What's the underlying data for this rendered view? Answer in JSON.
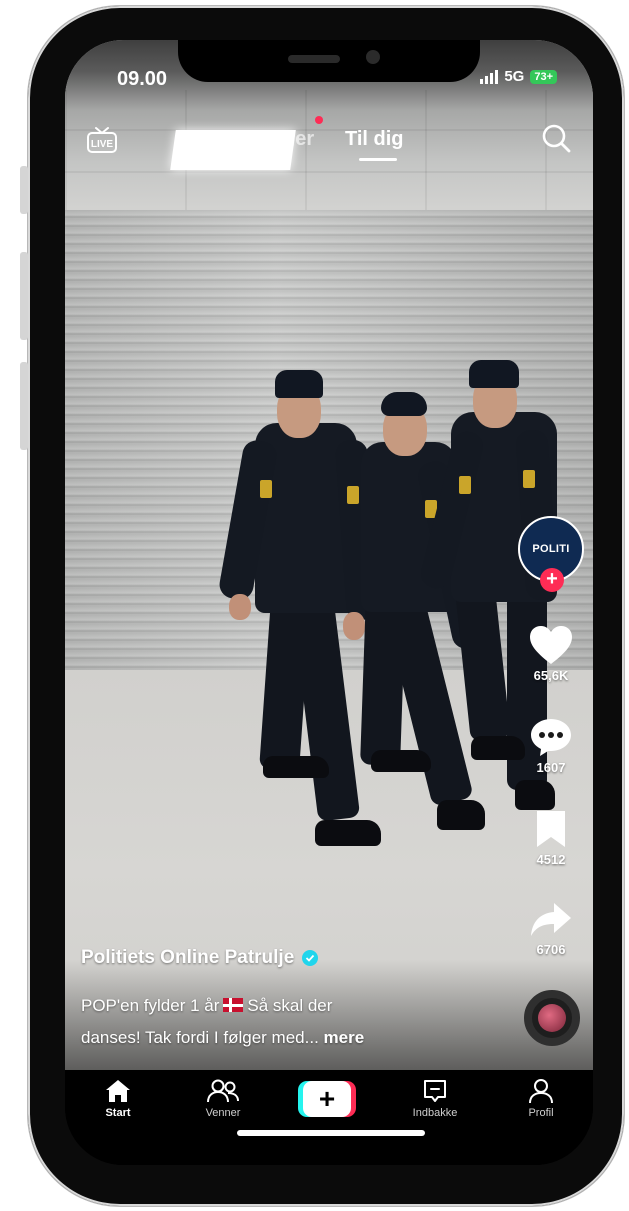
{
  "status_bar": {
    "time": "09.00",
    "network": "5G",
    "battery": "73+"
  },
  "top_tabs": {
    "following": "Følger",
    "for_you": "Til dig"
  },
  "icons": {
    "live": "live-tv-icon",
    "search": "search-icon"
  },
  "profile": {
    "avatar_text": "POLITI"
  },
  "actions": {
    "likes": "65,6K",
    "comments": "1607",
    "bookmarks": "4512",
    "shares": "6706"
  },
  "post": {
    "username": "Politiets Online Patrulje",
    "caption_line1_a": "POP'en fylder 1 år",
    "caption_line1_b": "Så skal der",
    "caption_line2": "danses! Tak fordi I følger med...",
    "more": "mere"
  },
  "nav": {
    "home": "Start",
    "friends": "Venner",
    "create": "+",
    "inbox": "Indbakke",
    "profile": "Profil"
  },
  "colors": {
    "accent_red": "#fe2c55",
    "accent_cyan": "#25f4ee",
    "verified": "#20d5ec",
    "battery": "#34c759"
  }
}
